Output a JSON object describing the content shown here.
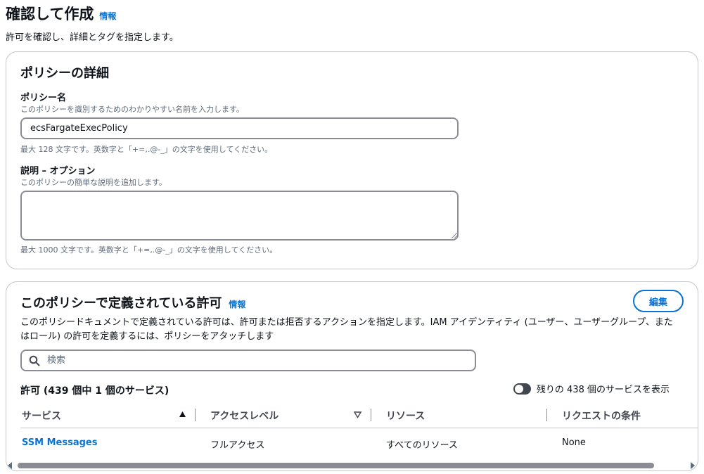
{
  "header": {
    "title": "確認して作成",
    "info_label": "情報",
    "description": "許可を確認し、詳細とタグを指定します。"
  },
  "policy_details": {
    "title": "ポリシーの詳細",
    "name_label": "ポリシー名",
    "name_desc": "このポリシーを識別するためのわかりやすい名前を入力します。",
    "name_value": "ecsFargateExecPolicy",
    "name_constraint": "最大 128 文字です。英数字と「+=,.@-_」の文字を使用してください。",
    "desc_label": "説明 – オプション",
    "desc_desc": "このポリシーの簡単な説明を追加します。",
    "desc_value": "",
    "desc_constraint": "最大 1000 文字です。英数字と「+=,.@-_」の文字を使用してください。"
  },
  "permissions": {
    "title": "このポリシーで定義されている許可",
    "info_label": "情報",
    "edit_label": "編集",
    "description": "このポリシードキュメントで定義されている許可は、許可または拒否するアクションを指定します。IAM アイデンティティ (ユーザー、ユーザーグループ、またはロール) の許可を定義するには、ポリシーをアタッチします",
    "search_placeholder": "検索",
    "count_label": "許可 (439 個中 1 個のサービス)",
    "toggle_label": "残りの 438 個のサービスを表示",
    "toggle_on": false,
    "columns": [
      "サービス",
      "アクセスレベル",
      "リソース",
      "リクエストの条件"
    ],
    "rows": [
      {
        "service": "SSM Messages",
        "access_level": "フルアクセス",
        "resource": "すべてのリソース",
        "condition": "None"
      }
    ]
  },
  "colors": {
    "accent": "#0972d3",
    "border": "#8c8c94",
    "text": "#0f141a",
    "muted": "#5f6b7a"
  }
}
